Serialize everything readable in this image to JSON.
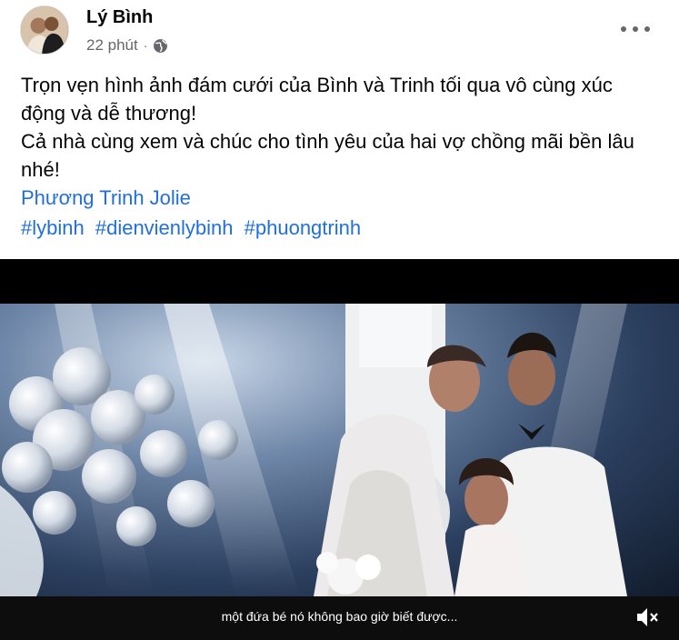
{
  "post": {
    "author": "Lý Bình",
    "time": "22 phút",
    "separator": "·",
    "text_lines": [
      "Trọn vẹn hình ảnh đám cưới của Bình và Trinh tối qua vô cùng xúc động và dễ thương!",
      "Cả nhà cùng xem và chúc cho tình yêu của hai vợ chồng mãi bền lâu nhé!"
    ],
    "mention": "Phương Trinh Jolie",
    "hashtags": [
      "#lybinh",
      "#dienvienlybinh",
      "#phuongtrinh"
    ]
  },
  "video": {
    "subtitle": "một đứa bé nó không bao giờ biết được..."
  },
  "icons": {
    "privacy": "globe-icon",
    "more": "more-options-icon",
    "mute": "speaker-muted-icon"
  },
  "colors": {
    "link": "#216fdb",
    "secondary_text": "#65676b",
    "video_bg": "#000000"
  }
}
